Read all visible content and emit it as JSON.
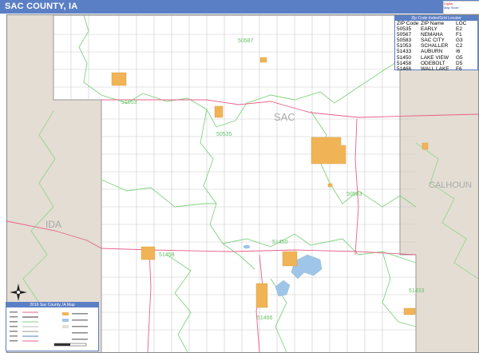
{
  "header": {
    "title": "SAC COUNTY, IA"
  },
  "logo": {
    "line1": "Digital",
    "line2": "Map Store",
    "line3": ""
  },
  "map": {
    "county_label": "SAC",
    "neighbors": {
      "west": "IDA",
      "east": "CALHOUN"
    },
    "zip_labels": [
      "50587",
      "51053",
      "50535",
      "50583",
      "51450",
      "51458",
      "51466",
      "51433"
    ],
    "colors": {
      "outside": "#e3ddd3",
      "zip_boundary": "#7fd47f",
      "city": "#f0b457",
      "water": "#9fc6e8",
      "highway": "#e8608a",
      "road": "#b9b9b9"
    }
  },
  "zip_index": {
    "title": "Zip Code Index/Grid Locator",
    "columns": [
      "ZIP Code",
      "ZIP Name",
      "LOC"
    ],
    "rows": [
      [
        "50535",
        "EARLY",
        "E2"
      ],
      [
        "50567",
        "NEMAHA",
        "F1"
      ],
      [
        "50583",
        "SAC CITY",
        "G3"
      ],
      [
        "51053",
        "SCHALLER",
        "C2"
      ],
      [
        "51433",
        "AUBURN",
        "I6"
      ],
      [
        "51450",
        "LAKE VIEW",
        "G5"
      ],
      [
        "51458",
        "ODEBOLT",
        "D5"
      ],
      [
        "51466",
        "WALL LAKE",
        "F6"
      ]
    ]
  },
  "legend": {
    "title": "2016 Sac County, IA Map"
  }
}
